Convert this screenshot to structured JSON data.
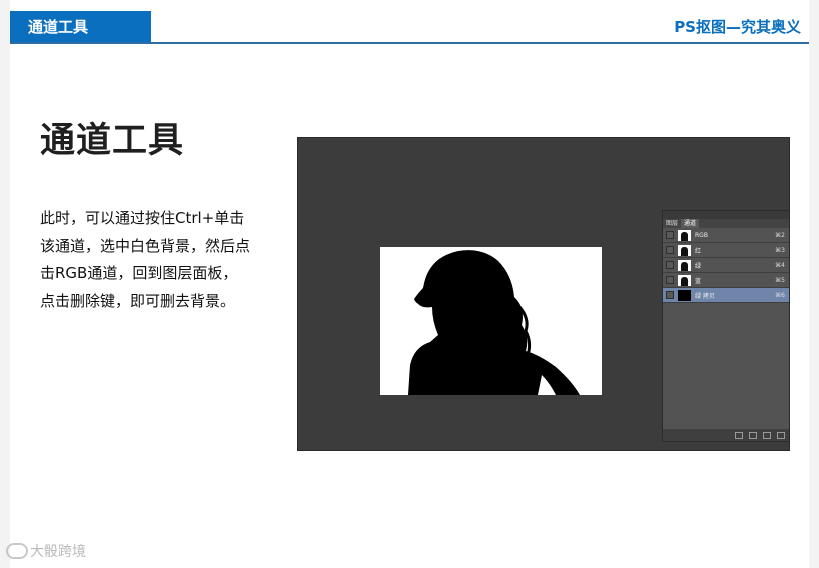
{
  "header": {
    "tab_label": "通道工具",
    "course_title": "PS抠图—究其奥义"
  },
  "main": {
    "title": "通道工具",
    "paragraph_lines": [
      "此时，可以通过按住Ctrl+单击",
      "该通道，选中白色背景，然后点",
      "击RGB通道，回到图层面板，",
      "点击删除键，即可删去背景。"
    ]
  },
  "ps_panel": {
    "tabs": [
      "图层",
      "通道"
    ],
    "channels": [
      {
        "label": "RGB",
        "shortcut": "⌘2"
      },
      {
        "label": "红",
        "shortcut": "⌘3"
      },
      {
        "label": "绿",
        "shortcut": "⌘4"
      },
      {
        "label": "蓝",
        "shortcut": "⌘5"
      },
      {
        "label": "绿 拷贝",
        "shortcut": "⌘6"
      }
    ]
  },
  "watermark": {
    "text": "大骰跨境"
  }
}
